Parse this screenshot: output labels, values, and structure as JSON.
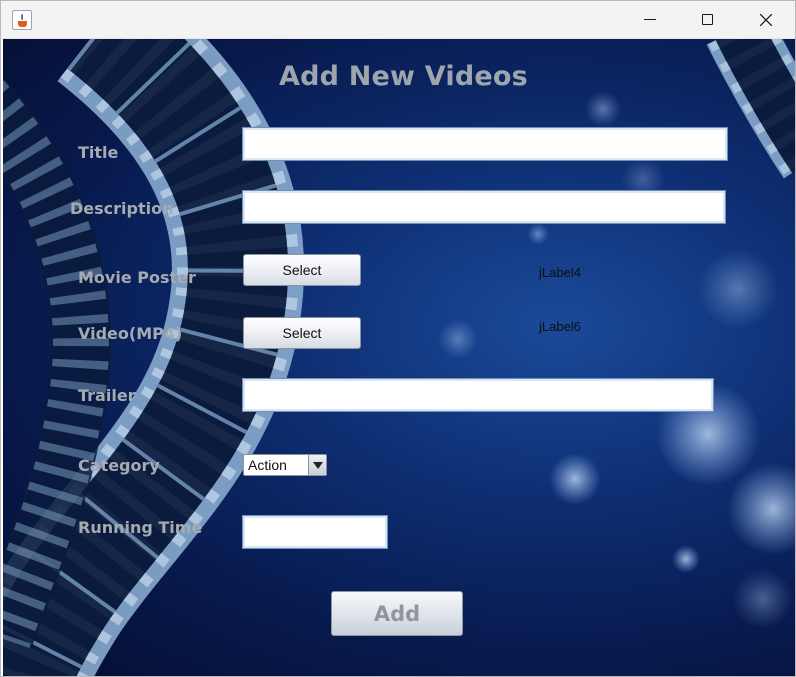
{
  "window": {
    "icon": "java-cup-icon",
    "controls": {
      "minimize": "minimize-icon",
      "maximize": "maximize-icon",
      "close": "close-icon"
    }
  },
  "form": {
    "heading": "Add New Videos",
    "labels": {
      "title": "Title",
      "description": "Description",
      "movie_poster": "Movie Poster",
      "video": "Video(MP4)",
      "trailer": "Trailer",
      "category": "Category",
      "running_time": "Running Time"
    },
    "fields": {
      "title_value": "",
      "description_value": "",
      "trailer_value": "",
      "running_time_value": ""
    },
    "buttons": {
      "poster_select": "Select",
      "video_select": "Select",
      "add": "Add"
    },
    "status_labels": {
      "poster": "jLabel4",
      "video": "jLabel6"
    },
    "category": {
      "selected": "Action"
    }
  },
  "colors": {
    "background_dark": "#040d30",
    "background_mid": "#1b4a9a",
    "label_text": "#a6abb2"
  }
}
